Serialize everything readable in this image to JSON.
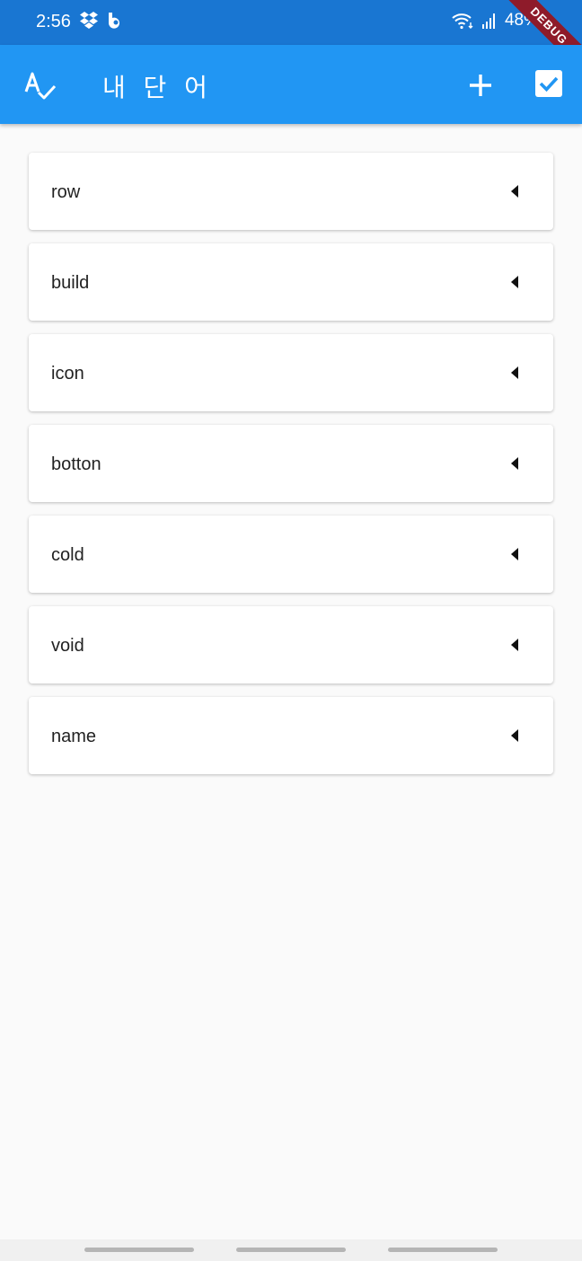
{
  "status_bar": {
    "time": "2:56",
    "battery": "48%",
    "debug_label": "DEBUG"
  },
  "app_bar": {
    "title": "내 단 어"
  },
  "words": [
    {
      "label": "row"
    },
    {
      "label": "build"
    },
    {
      "label": "icon"
    },
    {
      "label": "botton"
    },
    {
      "label": "cold"
    },
    {
      "label": "void"
    },
    {
      "label": "name"
    }
  ],
  "colors": {
    "status_bar": "#1976d2",
    "app_bar": "#2196f3",
    "background": "#fafafa",
    "card": "#ffffff"
  }
}
